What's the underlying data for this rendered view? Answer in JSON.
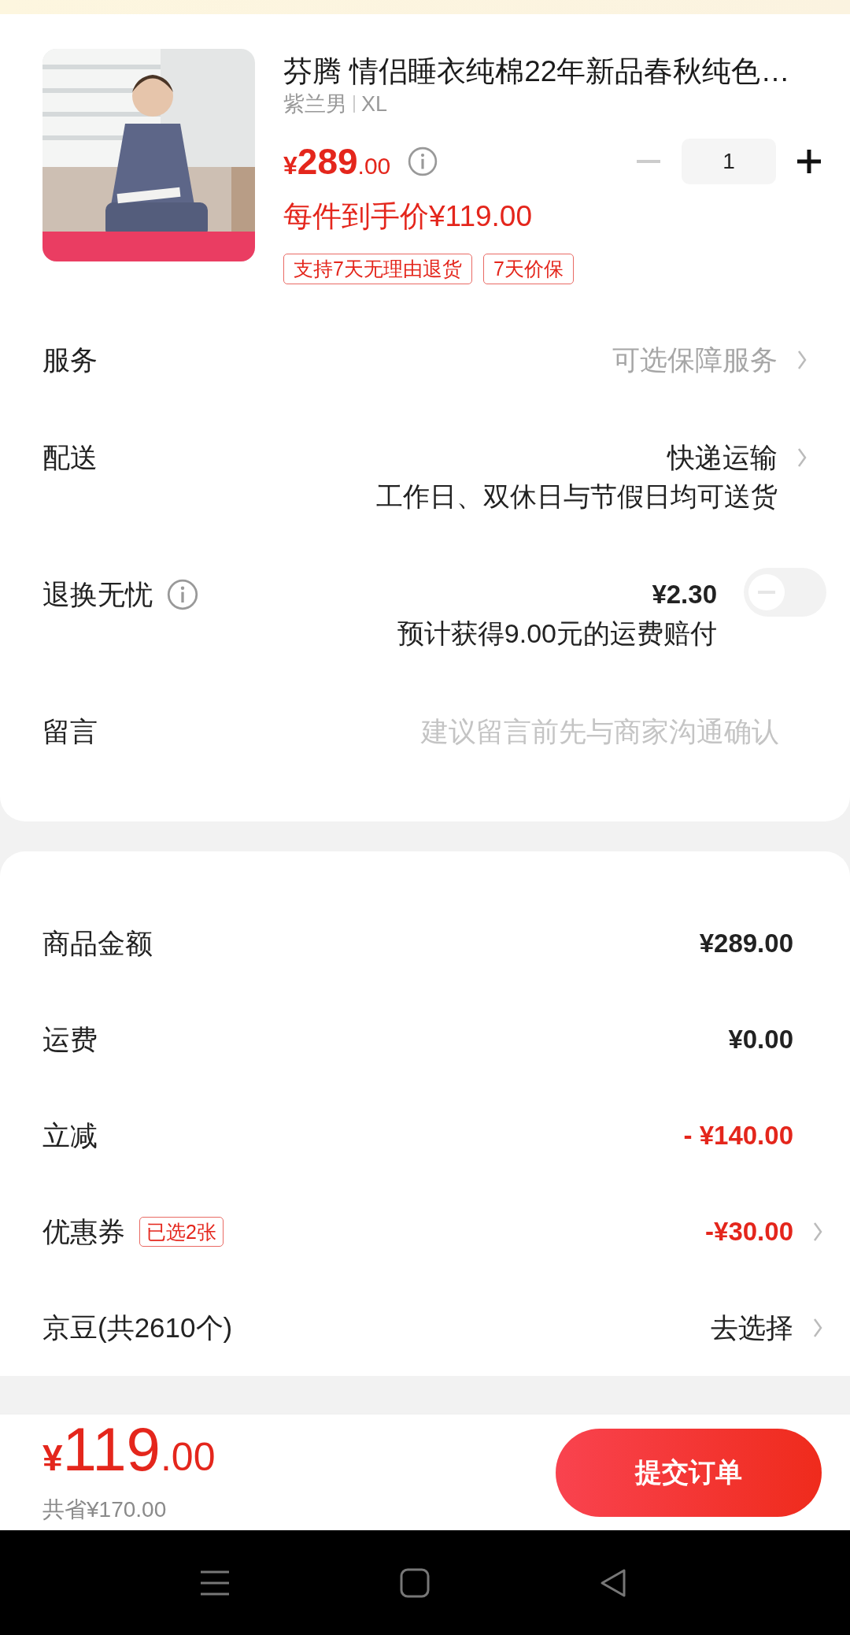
{
  "product": {
    "title": "芬腾 情侣睡衣纯棉22年新品春秋纯色…",
    "spec": "紫兰男",
    "size": "XL",
    "price_symbol": "¥",
    "price_int": "289",
    "price_dec": ".00",
    "unit_price": "每件到手价¥119.00",
    "quantity": "1",
    "tags": [
      "支持7天无理由退货",
      "7天价保"
    ]
  },
  "options": [
    {
      "kind": "link",
      "label": "服务",
      "value": "可选保障服务",
      "color": "#a6a6a6"
    },
    {
      "kind": "link",
      "label": "配送",
      "value": "快递运输",
      "color": "#222222",
      "note": "工作日、双休日与节假日均可送货"
    },
    {
      "kind": "toggle",
      "label": "退换无忧",
      "value": "¥2.30",
      "note": "预计获得9.00元的运费赔付",
      "on": false
    },
    {
      "kind": "input",
      "label": "留言",
      "placeholder": "建议留言前先与商家沟通确认"
    }
  ],
  "summary": [
    {
      "kind": "amount",
      "label": "商品金额",
      "value": "¥289.00",
      "color": "#222222",
      "arrow": false
    },
    {
      "kind": "amount",
      "label": "运费",
      "value": "¥0.00",
      "color": "#222222",
      "arrow": false
    },
    {
      "kind": "amount",
      "label": "立减",
      "value": "- ¥140.00",
      "color": "#e4261c",
      "arrow": false
    },
    {
      "kind": "amount",
      "label": "优惠券",
      "badge": "已选2张",
      "value": "-¥30.00",
      "color": "#e4261c",
      "arrow": true
    },
    {
      "kind": "action",
      "label": "京豆(共2610个)",
      "value": "去选择",
      "color": "#222222",
      "arrow": true
    }
  ],
  "footer": {
    "price_symbol": "¥",
    "price_int": "119",
    "price_dec": ".00",
    "saved": "共省¥170.00",
    "submit": "提交订单"
  }
}
